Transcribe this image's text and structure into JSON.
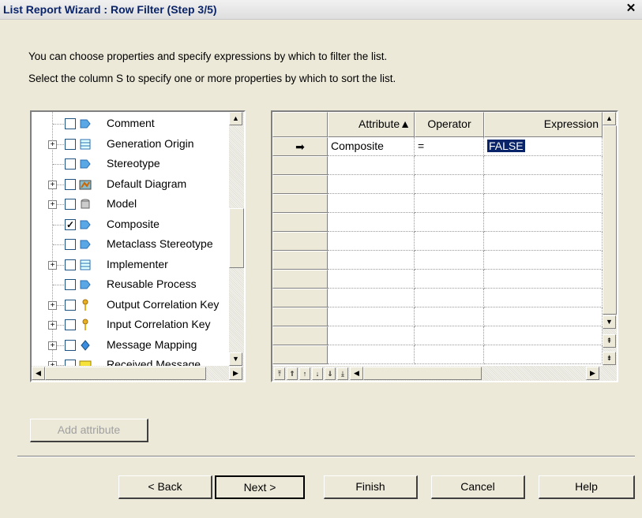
{
  "window": {
    "title": "List Report Wizard : Row Filter  (Step 3/5)",
    "close_glyph": "✕"
  },
  "instructions": [
    "You can choose properties and specify expressions by which to filter the list.",
    "Select the column S to specify one or more properties by which to sort the list."
  ],
  "tree": {
    "items": [
      {
        "label": "Comment",
        "expandable": false,
        "checked": false,
        "icon": "comment-icon"
      },
      {
        "label": "Generation Origin",
        "expandable": true,
        "checked": false,
        "icon": "list-icon"
      },
      {
        "label": "Stereotype",
        "expandable": false,
        "checked": false,
        "icon": "stereotype-icon"
      },
      {
        "label": "Default Diagram",
        "expandable": true,
        "checked": false,
        "icon": "diagram-icon"
      },
      {
        "label": "Model",
        "expandable": true,
        "checked": false,
        "icon": "model-icon"
      },
      {
        "label": "Composite",
        "expandable": false,
        "checked": true,
        "icon": "composite-icon"
      },
      {
        "label": "Metaclass Stereotype",
        "expandable": false,
        "checked": false,
        "icon": "stereotype-icon"
      },
      {
        "label": "Implementer",
        "expandable": true,
        "checked": false,
        "icon": "list-icon"
      },
      {
        "label": "Reusable Process",
        "expandable": false,
        "checked": false,
        "icon": "process-icon"
      },
      {
        "label": "Output Correlation Key",
        "expandable": true,
        "checked": false,
        "icon": "key-icon"
      },
      {
        "label": "Input Correlation Key",
        "expandable": true,
        "checked": false,
        "icon": "key-icon"
      },
      {
        "label": "Message Mapping",
        "expandable": true,
        "checked": false,
        "icon": "mapping-icon"
      },
      {
        "label": "Received Message",
        "expandable": true,
        "checked": false,
        "icon": "message-icon"
      }
    ]
  },
  "grid": {
    "columns": [
      "Attribute",
      "Operator",
      "Expression"
    ],
    "sort_indicator": "▲",
    "current_row_marker": "➡",
    "rows": [
      {
        "attribute": "Composite",
        "operator": "=",
        "expression": "FALSE"
      }
    ]
  },
  "buttons": {
    "add_attribute": "Add attribute",
    "back": "< Back",
    "next": "Next >",
    "finish": "Finish",
    "cancel": "Cancel",
    "help": "Help"
  },
  "colors": {
    "selection": "#0a246a",
    "dialog_bg": "#ece9d8"
  }
}
